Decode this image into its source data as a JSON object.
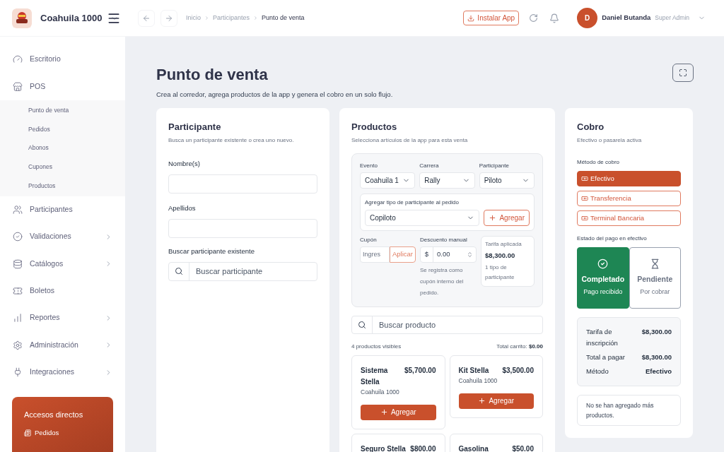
{
  "header": {
    "brand": "Coahuila 1000",
    "breadcrumb": [
      {
        "label": "Inicio",
        "current": false
      },
      {
        "label": "Participantes",
        "current": false
      },
      {
        "label": "Punto de venta",
        "current": true
      }
    ],
    "install_button": "Instalar App",
    "user": {
      "initial": "D",
      "name": "Daniel Butanda",
      "role": "Super Admin"
    }
  },
  "sidebar": {
    "items": [
      {
        "label": "Escritorio",
        "has_arrow": false,
        "expanded": false
      },
      {
        "label": "POS",
        "has_arrow": false,
        "expanded": true,
        "children": [
          {
            "label": "Punto de venta"
          },
          {
            "label": "Pedidos"
          },
          {
            "label": "Abonos"
          },
          {
            "label": "Cupones"
          },
          {
            "label": "Productos"
          }
        ]
      },
      {
        "label": "Participantes",
        "has_arrow": false,
        "expanded": false
      },
      {
        "label": "Validaciones",
        "has_arrow": true,
        "expanded": false
      },
      {
        "label": "Catálogos",
        "has_arrow": true,
        "expanded": false
      },
      {
        "label": "Boletos",
        "has_arrow": false,
        "expanded": false
      },
      {
        "label": "Reportes",
        "has_arrow": true,
        "expanded": false
      },
      {
        "label": "Administración",
        "has_arrow": true,
        "expanded": false
      },
      {
        "label": "Integraciones",
        "has_arrow": true,
        "expanded": false
      }
    ],
    "shortcuts": {
      "title": "Accesos directos",
      "items": [
        "Pedidos"
      ]
    }
  },
  "page": {
    "title": "Punto de venta",
    "subtitle": "Crea al corredor, agrega productos de la app y genera el cobro en un solo flujo."
  },
  "participant": {
    "title": "Participante",
    "subtitle": "Busca un participante existente o crea uno nuevo.",
    "fields": [
      {
        "label": "Nombre(s)"
      },
      {
        "label": "Apellidos"
      }
    ],
    "search_label": "Buscar participante existente",
    "search_placeholder": "Buscar participante"
  },
  "products": {
    "title": "Productos",
    "subtitle": "Selecciona artículos de la app para esta venta",
    "selects": [
      {
        "label": "Evento",
        "value": "Coahuila 1"
      },
      {
        "label": "Carrera",
        "value": "Rally"
      },
      {
        "label": "Participante",
        "value": "Piloto"
      }
    ],
    "add_type": {
      "label": "Agregar tipo de participante al pedido",
      "value": "Copiloto",
      "button": "Agregar"
    },
    "coupon": {
      "label": "Cupón",
      "placeholder": "Ingres",
      "button": "Aplicar"
    },
    "discount": {
      "label": "Descuento manual",
      "currency": "$",
      "value": "0.00",
      "note": "Se registra como cupón interno del pedido."
    },
    "rate": {
      "label": "Tarifa aplicada",
      "amount": "$8,300.00",
      "note": "1 tipo de participante"
    },
    "search_placeholder": "Buscar producto",
    "count": "4 productos visibles",
    "total_label": "Total carrito:",
    "total": "$0.00",
    "items": [
      {
        "name": "Sistema Stella",
        "price": "$5,700.00",
        "event": "Coahuila 1000",
        "button": "Agregar"
      },
      {
        "name": "Kit Stella",
        "price": "$3,500.00",
        "event": "Coahuila 1000",
        "button": "Agregar"
      },
      {
        "name": "Seguro Stella",
        "price": "$800.00"
      },
      {
        "name": "Gasolina",
        "price": "$50.00"
      }
    ]
  },
  "payment": {
    "title": "Cobro",
    "subtitle": "Efectivo o pasarela activa",
    "method_label": "Método de cobro",
    "methods": [
      {
        "label": "Efectivo",
        "selected": true
      },
      {
        "label": "Transferencia",
        "selected": false
      },
      {
        "label": "Terminal Bancaria",
        "selected": false
      }
    ],
    "status_label": "Estado del pago en efectivo",
    "statuses": [
      {
        "kind": "done",
        "title": "Completado",
        "note": "Pago recibido",
        "selected": true
      },
      {
        "kind": "pending",
        "title": "Pendiente",
        "note": "Por cobrar",
        "selected": false
      }
    ],
    "summary": [
      {
        "label": "Tarifa de inscripción",
        "value": "$8,300.00"
      },
      {
        "label": "Total a pagar",
        "value": "$8,300.00"
      },
      {
        "label": "Método",
        "value": "Efectivo"
      }
    ],
    "note": "No se han agregado más productos."
  }
}
